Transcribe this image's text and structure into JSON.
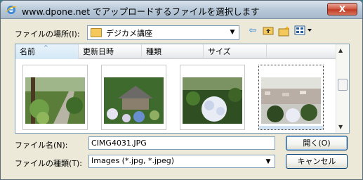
{
  "window": {
    "title": "www.dpone.net でアップロードするファイルを選択します",
    "close_label": "X"
  },
  "location": {
    "label": "ファイルの場所(I):",
    "value": "デジカメ講座"
  },
  "toolbar": {
    "icons": [
      "back-arrow-icon",
      "up-folder-icon",
      "new-folder-icon",
      "view-menu-icon"
    ]
  },
  "listview": {
    "columns": [
      "名前",
      "更新日時",
      "種類",
      "サイズ"
    ],
    "sorted_column": "名前",
    "thumbnails": [
      {
        "name": "garden-path-photo",
        "selected": false
      },
      {
        "name": "temple-hydrangea-photo",
        "selected": false
      },
      {
        "name": "hydrangea-closeup-photo",
        "selected": false
      },
      {
        "name": "town-view-photo",
        "selected": true
      }
    ]
  },
  "filename": {
    "label": "ファイル名(N):",
    "value": "CIMG4031.JPG"
  },
  "filetype": {
    "label": "ファイルの種類(T):",
    "value": "Images (*.jpg, *.jpeg)"
  },
  "buttons": {
    "open_label": "開く(O)",
    "cancel_label": "キャンセル"
  },
  "colors": {
    "accent": "#003c74",
    "selection": "#cfe3f5"
  }
}
